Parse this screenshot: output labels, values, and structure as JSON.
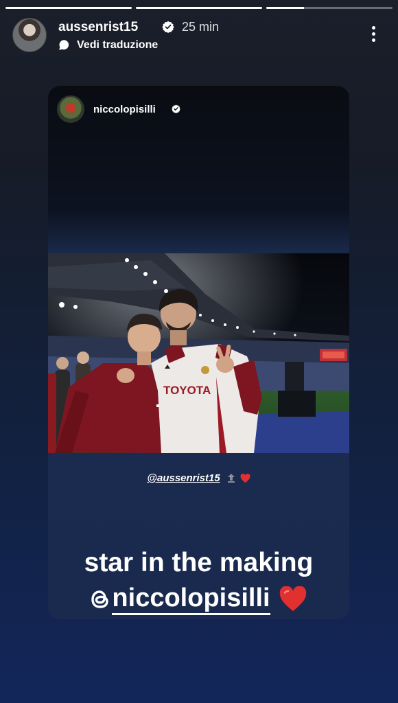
{
  "story": {
    "progress": [
      1.0,
      1.0,
      0.3
    ]
  },
  "header": {
    "username": "aussenrist15",
    "time": "25 min",
    "translate_label": "Vedi traduzione"
  },
  "card": {
    "username": "niccolopisilli",
    "mention": "@aussenrist15",
    "caption_line1": "star in the making",
    "caption_handle": "niccolopisilli"
  },
  "photo": {
    "shirt_text": "TOYOTA"
  },
  "colors": {
    "heart": "#e0302f",
    "accent_red": "#8a1a22"
  }
}
